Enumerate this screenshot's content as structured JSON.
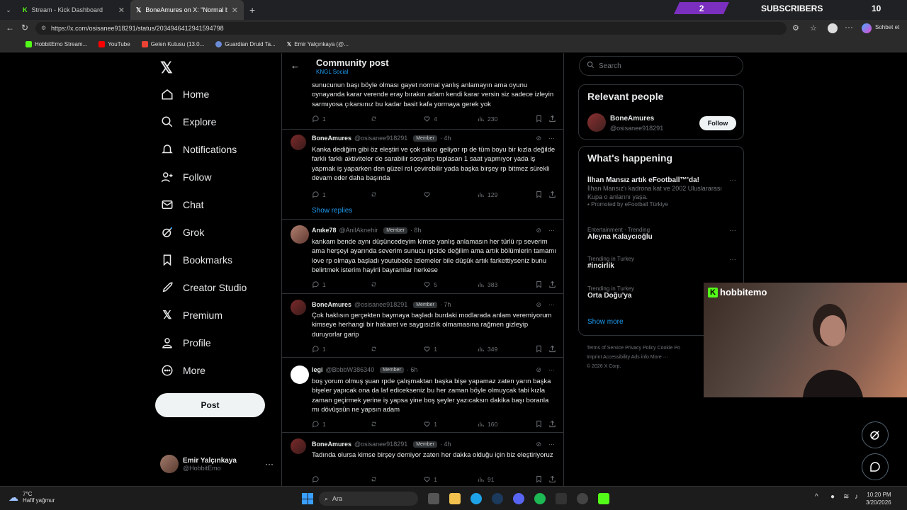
{
  "browser": {
    "tabs": [
      {
        "label": "Stream - Kick Dashboard",
        "active": false
      },
      {
        "label": "BoneAmures on X: \"Normal bir rp",
        "active": true
      }
    ],
    "url": "https://x.com/osisanee918291/status/2034946412941594798",
    "bookmarks": [
      "HobbitEmo Stream...",
      "YouTube",
      "Gelen Kutusu (13.0...",
      "Guardian Druid Ta...",
      "Emir Yalçınkaya (@..."
    ],
    "profile_label": "Sohbet et"
  },
  "overlay": {
    "subs_count": "2",
    "subs_label": "SUBSCRIBERS",
    "count_right": "10",
    "cam_name": "hobbitemo"
  },
  "nav": {
    "items": [
      "Home",
      "Explore",
      "Notifications",
      "Follow",
      "Chat",
      "Grok",
      "Bookmarks",
      "Creator Studio",
      "Premium",
      "Profile",
      "More"
    ],
    "post_label": "Post",
    "account_name": "Emir Yalçınkaya",
    "account_handle": "@HobbitEmo"
  },
  "header": {
    "title": "Community post",
    "subtitle": "KNGL Social"
  },
  "replies": [
    {
      "name": "",
      "handle": "",
      "badge": "",
      "time": "",
      "text": "sunucunun başı böyle olması gayet normal yanlış anlamayın ama oyunu oynayanda karar verende eray bırakın adam kendi karar versin siz sadece izleyin sarmıyosa çıkarsınız bu kadar basit kafa yormaya gerek yok",
      "replies": "1",
      "reposts": "",
      "likes": "4",
      "views": "230"
    },
    {
      "name": "BoneAmures",
      "handle": "@osisanee918291",
      "badge": "Member",
      "time": "· 4h",
      "text": "Kanka dediğim gibi öz eleştiri ve çok sıkıcı geliyor rp de tüm boyu bir kızla değilde farklı farklı aktiviteler de sarabilir sosyalrp toplasan 1 saat yapmıyor yada iş yapmak iş yaparken den güzel rol çevirebilir yada başka birşey rp bitmez sürekli devam eder daha başında",
      "replies": "1",
      "reposts": "",
      "likes": "",
      "views": "129"
    },
    {
      "name": "Anıke78",
      "handle": "@AnilAknehir",
      "badge": "Member",
      "time": "· 8h",
      "text": "kankam bende aynı düşüncedeyim kimse yanlış anlamasın her türlü rp severim ama herşeyi ayarında severim sunucu rpcide değilim ama artık bölümlerin tamamı love rp olmaya başladı youtubede izlemeler bile düşük artık farkettiyseniz bunu belirtmek isterim hayirli bayramlar herkese",
      "replies": "1",
      "reposts": "",
      "likes": "5",
      "views": "383"
    },
    {
      "name": "BoneAmures",
      "handle": "@osisanee918291",
      "badge": "Member",
      "time": "· 7h",
      "text": "Çok haklısın gerçekten baymaya başladı burdaki modlarada anlam veremiyorum kimseye herhangi bir hakaret ve saygısızlık olmamasına rağmen gizleyip duruyorlar garip",
      "replies": "1",
      "reposts": "",
      "likes": "1",
      "views": "349"
    },
    {
      "name": "legi",
      "handle": "@BbbbW386340",
      "badge": "Member",
      "time": "· 6h",
      "text": "boş yorum olmuş şuan rpde çalışmaktan başka bişe yapamaz zaten yarın başka bişeler yapıcak ona da laf edicekseniz bu her zaman böyle olmuycak tabi kızla zaman geçirmek yerine iş yapsa yine boş şeyler yazıcaksın dakika başı boranla mı dövüşsün ne yapsın adam",
      "replies": "1",
      "reposts": "",
      "likes": "1",
      "views": "160"
    },
    {
      "name": "BoneAmures",
      "handle": "@osisanee918291",
      "badge": "Member",
      "time": "· 4h",
      "text": "Tadında olursa kimse birşey demiyor zaten her dakka olduğu için biz eleştiriyoruz",
      "replies": "",
      "reposts": "",
      "likes": "1",
      "views": "91"
    }
  ],
  "show_replies": "Show replies",
  "right": {
    "search_placeholder": "Search",
    "relevant_title": "Relevant people",
    "relevant_name": "BoneAmures",
    "relevant_handle": "@osisanee918291",
    "follow_label": "Follow",
    "happening_title": "What's happening",
    "trends": [
      {
        "meta": "",
        "name": "İlhan Mansız artık eFootball™'da!",
        "desc": "İlhan Mansız'ı kadrona kat ve 2002 Uluslararası Kupa o anlarını yaşa.",
        "promo": "Promoted by eFootball Türkiye"
      },
      {
        "meta": "Entertainment · Trending",
        "name": "Aleyna Kalaycıoğlu",
        "desc": "",
        "promo": ""
      },
      {
        "meta": "Trending in Turkey",
        "name": "#incirlik",
        "desc": "",
        "promo": ""
      },
      {
        "meta": "Trending in Turkey",
        "name": "Orta Doğu'ya",
        "desc": "",
        "promo": ""
      }
    ],
    "show_more": "Show more",
    "footer_line1": "Terms of Service   Privacy Policy   Cookie Po",
    "footer_line2": "Imprint   Accessibility   Ads info   More ···",
    "footer_line3": "© 2026 X Corp."
  },
  "taskbar": {
    "temp": "7°C",
    "weather": "Hafif yağmur",
    "search": "Ara",
    "time": "10:20 PM",
    "date": "3/20/2026"
  }
}
